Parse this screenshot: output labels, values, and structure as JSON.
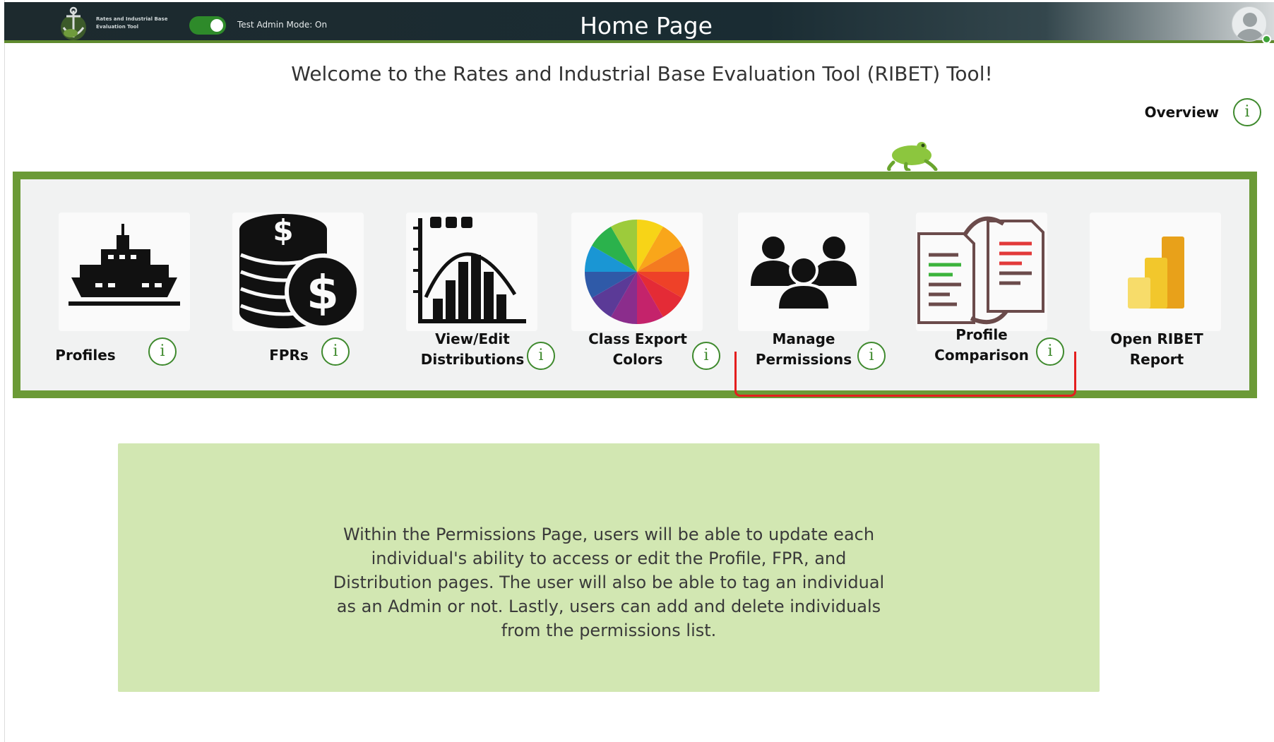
{
  "header": {
    "logo_text": "Rates and Industrial Base Evaluation Tool",
    "toggle_label": "Test Admin Mode: On",
    "toggle_state": "on",
    "title": "Home Page"
  },
  "welcome_text": "Welcome to the Rates and Industrial Base Evaluation Tool (RIBET) Tool!",
  "overview": {
    "label": "Overview",
    "info_glyph": "i"
  },
  "nav_tiles": [
    {
      "label": "Profiles",
      "icon": "ship-icon",
      "info_glyph": "i"
    },
    {
      "label": "FPRs",
      "icon": "coins-dollar-icon",
      "info_glyph": "i"
    },
    {
      "label": "View/Edit Distributions",
      "icon": "histogram-icon",
      "info_glyph": "i"
    },
    {
      "label": "Class Export Colors",
      "icon": "color-wheel-icon",
      "info_glyph": "i"
    },
    {
      "label": "Manage Permissions",
      "icon": "people-group-icon",
      "info_glyph": "i"
    },
    {
      "label": "Profile Comparison",
      "icon": "document-compare-icon",
      "info_glyph": "i"
    },
    {
      "label": "Open RIBET Report",
      "icon": "power-bi-icon"
    }
  ],
  "description": "Within the Permissions Page, users will be able to update each individual's ability to access or edit the Profile, FPR, and Distribution pages. The user will also be able to tag an individual as an Admin or not. Lastly, users can add and delete individuals from the permissions list.",
  "colors": {
    "accent_green": "#6b9a36",
    "highlight_red": "#e41e1e",
    "description_bg": "#d2e7b2",
    "header_dark": "#1d2a2e"
  }
}
